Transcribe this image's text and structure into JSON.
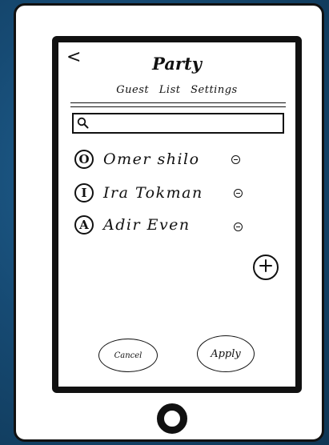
{
  "screen": {
    "title": "Party",
    "back_glyph": "<",
    "tabs": [
      {
        "label": "Guest"
      },
      {
        "label": "List"
      },
      {
        "label": "Settings"
      }
    ],
    "search": {
      "placeholder": ""
    },
    "guests": [
      {
        "initial": "O",
        "name": "Omer shilo"
      },
      {
        "initial": "I",
        "name": "Ira Tokman"
      },
      {
        "initial": "A",
        "name": "Adir Even"
      }
    ],
    "actions": {
      "cancel_label": "Cancel",
      "apply_label": "Apply"
    }
  },
  "icons": {
    "back": "back-arrow-icon",
    "search": "search-icon",
    "remove": "minus-circle-icon",
    "add": "plus-circle-icon",
    "home": "home-button-icon"
  },
  "colors": {
    "background": "#164a73",
    "frame": "#111111",
    "surface": "#ffffff"
  }
}
